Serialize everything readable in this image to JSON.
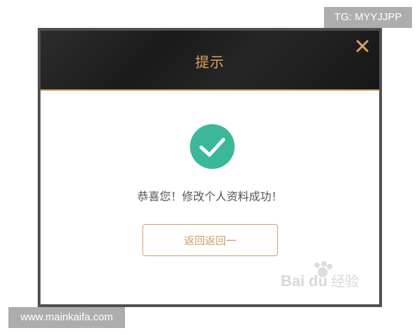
{
  "dialog": {
    "title": "提示",
    "close_icon": "close-icon",
    "success_icon": "check-circle-icon",
    "message": "恭喜您！修改个人资料成功！",
    "back_button_label": "返回返回一"
  },
  "watermarks": {
    "tg": "TG: MYYJJPP",
    "site": "www.mainkaifa.com",
    "baidu_logo": "Baidu 经验"
  },
  "colors": {
    "header_bg": "#1f1f1f",
    "accent_gold": "#d9a45f",
    "success_green": "#3bb89a",
    "frame_gray": "#4f4f4f"
  }
}
